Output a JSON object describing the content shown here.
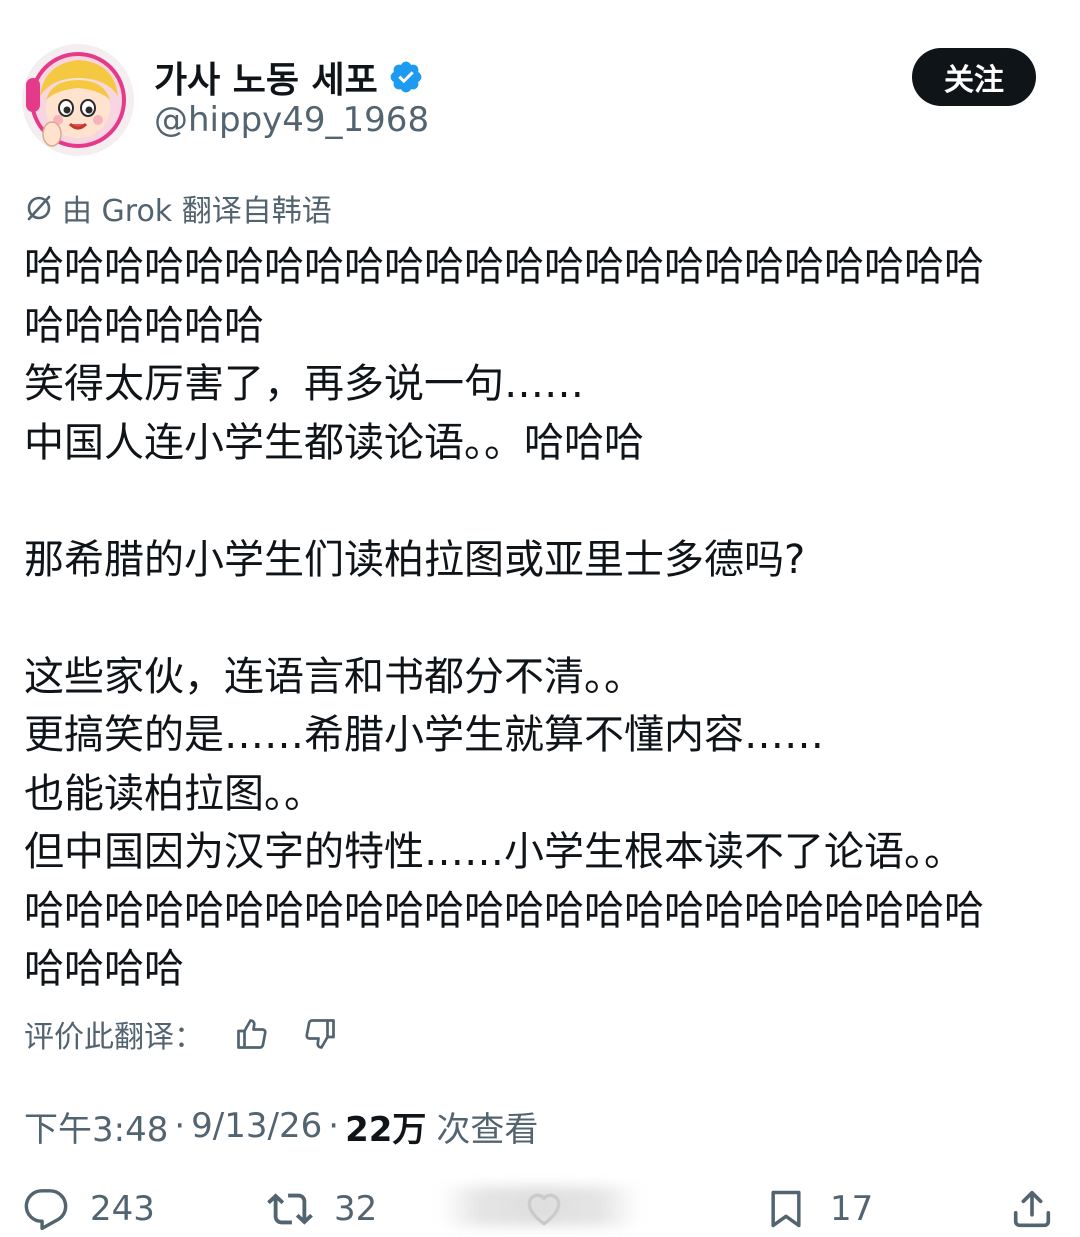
{
  "profile": {
    "display_name": "가사 노동 세포",
    "handle": "@hippy49_1968",
    "verified": true,
    "verified_color": "#1d9bf0",
    "avatar_icon": "cartoon-avatar"
  },
  "follow_button": {
    "label": "关注"
  },
  "translation": {
    "note": "由 Grok 翻译自韩语",
    "icon": "grok-icon"
  },
  "tweet": {
    "lines": [
      "哈哈哈哈哈哈哈哈哈哈哈哈哈哈哈哈哈哈哈哈哈哈哈哈",
      "哈哈哈哈哈哈",
      "笑得太厉害了，再多说一句……",
      "中国人连小学生都读论语。。哈哈哈",
      "",
      "那希腊的小学生们读柏拉图或亚里士多德吗?",
      "",
      "这些家伙，连语言和书都分不清。。",
      "更搞笑的是……希腊小学生就算不懂内容……",
      "也能读柏拉图。。",
      "但中国因为汉字的特性……小学生根本读不了论语。。",
      "哈哈哈哈哈哈哈哈哈哈哈哈哈哈哈哈哈哈哈哈哈哈哈哈",
      "哈哈哈哈"
    ]
  },
  "rate_translation": {
    "label": "评价此翻译："
  },
  "meta": {
    "time": "下午3:48",
    "separator": "·",
    "date": "9/13/26",
    "views_count": "22万",
    "views_label": "次查看"
  },
  "actions": {
    "reply_count": "243",
    "retweet_count": "32",
    "bookmark_count": "17"
  },
  "colors": {
    "text_primary": "#0f1419",
    "text_secondary": "#536471",
    "follow_bg": "#0f1419",
    "verified": "#1d9bf0"
  }
}
